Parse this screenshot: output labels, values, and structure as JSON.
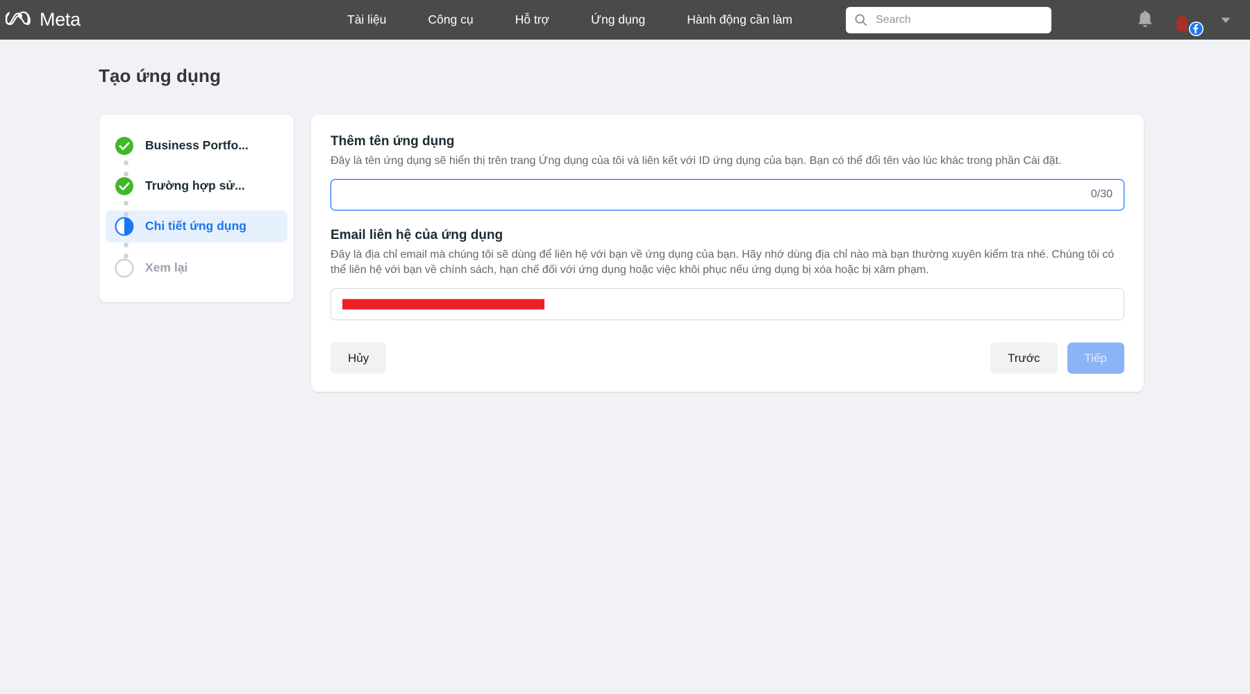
{
  "topbar": {
    "brand_name": "Meta",
    "brand_icon": "meta-infinity-logo",
    "nav_items": [
      {
        "label": "Tài liệu"
      },
      {
        "label": "Công cụ"
      },
      {
        "label": "Hỗ trợ"
      },
      {
        "label": "Ứng dụng"
      },
      {
        "label": "Hành động cần làm"
      }
    ],
    "search": {
      "placeholder": "Search",
      "value": "",
      "icon": "search-icon"
    },
    "bell_icon": "notification-bell-icon",
    "avatar_badge_icon": "facebook-badge-icon",
    "chevron_icon": "chevron-down-icon"
  },
  "page": {
    "title": "Tạo ứng dụng"
  },
  "stepper": {
    "steps": [
      {
        "label": "Business Portfo...",
        "state": "completed",
        "icon": "check-circle-icon"
      },
      {
        "label": "Trường hợp sử...",
        "state": "completed",
        "icon": "check-circle-icon"
      },
      {
        "label": "Chi tiết ứng dụng",
        "state": "current",
        "icon": "half-filled-circle-icon"
      },
      {
        "label": "Xem lại",
        "state": "todo",
        "icon": "empty-circle-icon"
      }
    ]
  },
  "form": {
    "app_name": {
      "title": "Thêm tên ứng dụng",
      "description": "Đây là tên ứng dụng sẽ hiển thị trên trang Ứng dụng của tôi và liên kết với ID ứng dụng của bạn. Bạn có thể đổi tên vào lúc khác trong phần Cài đặt.",
      "value": "",
      "placeholder": "",
      "counter": "0/30"
    },
    "contact_email": {
      "title": "Email liên hệ của ứng dụng",
      "description": "Đây là địa chỉ email mà chúng tôi sẽ dùng để liên hệ với bạn về ứng dụng của bạn. Hãy nhớ dùng địa chỉ nào mà bạn thường xuyên kiểm tra nhé. Chúng tôi có thể liên hệ với bạn về chính sách, hạn chế đối với ứng dụng hoặc việc khôi phục nếu ứng dụng bị xóa hoặc bị xâm phạm.",
      "value": "",
      "redacted": true
    }
  },
  "actions": {
    "cancel_label": "Hủy",
    "back_label": "Trước",
    "next_label": "Tiếp"
  },
  "colors": {
    "topbar_bg": "#4a4a4a",
    "page_bg": "#f0f2f5",
    "accent_blue": "#1877f2",
    "current_step_bg": "#e7f0fd",
    "success_green": "#42b72a",
    "disabled_primary": "#8ab4f5",
    "redaction_red": "#ec2024"
  }
}
